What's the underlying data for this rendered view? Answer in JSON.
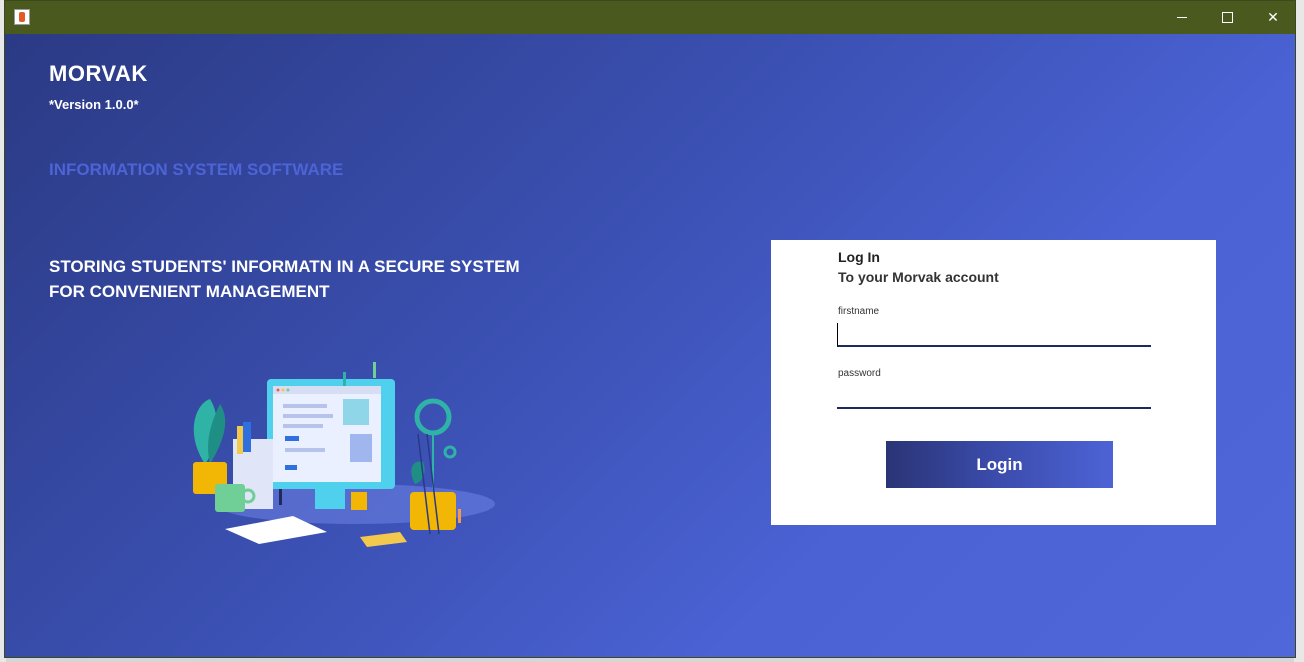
{
  "window": {
    "title": "",
    "controls": {
      "minimize_icon": "minimize-icon",
      "maximize_icon": "maximize-icon",
      "close_glyph": "✕"
    }
  },
  "brand": {
    "name": "MORVAK",
    "version": "*Version 1.0.0*",
    "subtitle": "INFORMATION SYSTEM SOFTWARE",
    "tagline_line1": "STORING STUDENTS' INFORMATN IN A SECURE SYSTEM",
    "tagline_line2": "FOR CONVENIENT MANAGEMENT"
  },
  "login": {
    "title": "Log In",
    "subtitle": "To your Morvak account",
    "firstname_label": "firstname",
    "firstname_value": "",
    "password_label": "password",
    "password_value": "",
    "button_label": "Login"
  },
  "colors": {
    "titlebar": "#4a5a1f",
    "gradient_start": "#2b3a84",
    "gradient_end": "#4f67d8",
    "accent_text": "#4d63d6"
  }
}
